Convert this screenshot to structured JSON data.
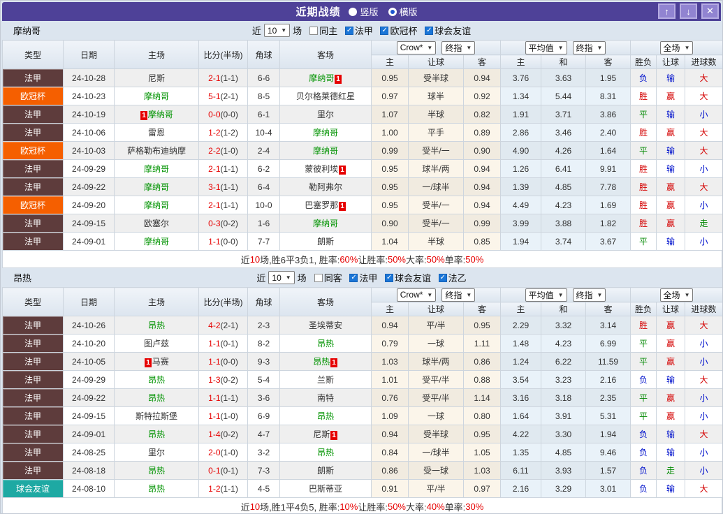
{
  "title_bar": {
    "title": "近期战绩",
    "radio_vertical": "竖版",
    "radio_horizontal": "横版"
  },
  "icons": {
    "up": "↑",
    "down": "↓",
    "close": "✕",
    "dropdown": "▼"
  },
  "columns": {
    "type": "类型",
    "date": "日期",
    "home": "主场",
    "score": "比分(半场)",
    "corner": "角球",
    "away": "客场",
    "crow_select": "Crow*",
    "final_select": "终指",
    "avg_select": "平均值",
    "final_select2": "终指",
    "full_select": "全场",
    "sub_home": "主",
    "sub_handicap": "让球",
    "sub_away": "客",
    "sub_avg_home": "主",
    "sub_avg_draw": "和",
    "sub_avg_away": "客",
    "sub_wdl": "胜负",
    "sub_let": "让球",
    "sub_goals": "进球数"
  },
  "monaco": {
    "team": "摩纳哥",
    "filter": {
      "recent_label": "近",
      "count": "10",
      "matches_label": "场",
      "checkboxes": [
        {
          "label": "同主",
          "state": ""
        },
        {
          "label": "法甲",
          "state": "on"
        },
        {
          "label": "欧冠杯",
          "state": "on"
        },
        {
          "label": "球会友谊",
          "state": "on"
        }
      ]
    },
    "rows": [
      {
        "type": "法甲",
        "tc": "ligue1",
        "date": "24-10-28",
        "hcard": "",
        "home": "尼斯",
        "hc": "",
        "ft": "2-1",
        "ht": "(1-1)",
        "corner": "6-6",
        "away": "摩纳哥",
        "ac": "self",
        "acard": "1",
        "o1": "0.95",
        "hd": "受半球",
        "o2": "0.94",
        "m1": "3.76",
        "m2": "3.63",
        "m3": "1.95",
        "r1": "负",
        "r1c": "blue",
        "r2": "输",
        "r2c": "blue",
        "r3": "大",
        "r3c": "red"
      },
      {
        "type": "欧冠杯",
        "tc": "ucl",
        "date": "24-10-23",
        "hcard": "",
        "home": "摩纳哥",
        "hc": "self",
        "ft": "5-1",
        "ht": "(2-1)",
        "corner": "8-5",
        "away": "贝尔格莱德红星",
        "ac": "",
        "acard": "",
        "o1": "0.97",
        "hd": "球半",
        "o2": "0.92",
        "m1": "1.34",
        "m2": "5.44",
        "m3": "8.31",
        "r1": "胜",
        "r1c": "red",
        "r2": "赢",
        "r2c": "red",
        "r3": "大",
        "r3c": "red"
      },
      {
        "type": "法甲",
        "tc": "ligue1",
        "date": "24-10-19",
        "hcard": "1",
        "home": "摩纳哥",
        "hc": "self",
        "ft": "0-0",
        "ht": "(0-0)",
        "corner": "6-1",
        "away": "里尔",
        "ac": "",
        "acard": "",
        "o1": "1.07",
        "hd": "半球",
        "o2": "0.82",
        "m1": "1.91",
        "m2": "3.71",
        "m3": "3.86",
        "r1": "平",
        "r1c": "green",
        "r2": "输",
        "r2c": "blue",
        "r3": "小",
        "r3c": "blue"
      },
      {
        "type": "法甲",
        "tc": "ligue1",
        "date": "24-10-06",
        "hcard": "",
        "home": "雷恩",
        "hc": "",
        "ft": "1-2",
        "ht": "(1-2)",
        "corner": "10-4",
        "away": "摩纳哥",
        "ac": "self",
        "acard": "",
        "o1": "1.00",
        "hd": "平手",
        "o2": "0.89",
        "m1": "2.86",
        "m2": "3.46",
        "m3": "2.40",
        "r1": "胜",
        "r1c": "red",
        "r2": "赢",
        "r2c": "red",
        "r3": "大",
        "r3c": "red"
      },
      {
        "type": "欧冠杯",
        "tc": "ucl",
        "date": "24-10-03",
        "hcard": "",
        "home": "萨格勒布迪纳摩",
        "hc": "",
        "ft": "2-2",
        "ht": "(1-0)",
        "corner": "2-4",
        "away": "摩纳哥",
        "ac": "self",
        "acard": "",
        "o1": "0.99",
        "hd": "受半/一",
        "o2": "0.90",
        "m1": "4.90",
        "m2": "4.26",
        "m3": "1.64",
        "r1": "平",
        "r1c": "green",
        "r2": "输",
        "r2c": "blue",
        "r3": "大",
        "r3c": "red"
      },
      {
        "type": "法甲",
        "tc": "ligue1",
        "date": "24-09-29",
        "hcard": "",
        "home": "摩纳哥",
        "hc": "self",
        "ft": "2-1",
        "ht": "(1-1)",
        "corner": "6-2",
        "away": "蒙彼利埃",
        "ac": "",
        "acard": "1",
        "o1": "0.95",
        "hd": "球半/两",
        "o2": "0.94",
        "m1": "1.26",
        "m2": "6.41",
        "m3": "9.91",
        "r1": "胜",
        "r1c": "red",
        "r2": "输",
        "r2c": "blue",
        "r3": "小",
        "r3c": "blue"
      },
      {
        "type": "法甲",
        "tc": "ligue1",
        "date": "24-09-22",
        "hcard": "",
        "home": "摩纳哥",
        "hc": "self",
        "ft": "3-1",
        "ht": "(1-1)",
        "corner": "6-4",
        "away": "勒阿弗尔",
        "ac": "",
        "acard": "",
        "o1": "0.95",
        "hd": "一/球半",
        "o2": "0.94",
        "m1": "1.39",
        "m2": "4.85",
        "m3": "7.78",
        "r1": "胜",
        "r1c": "red",
        "r2": "赢",
        "r2c": "red",
        "r3": "大",
        "r3c": "red"
      },
      {
        "type": "欧冠杯",
        "tc": "ucl",
        "date": "24-09-20",
        "hcard": "",
        "home": "摩纳哥",
        "hc": "self",
        "ft": "2-1",
        "ht": "(1-1)",
        "corner": "10-0",
        "away": "巴塞罗那",
        "ac": "",
        "acard": "1",
        "o1": "0.95",
        "hd": "受半/一",
        "o2": "0.94",
        "m1": "4.49",
        "m2": "4.23",
        "m3": "1.69",
        "r1": "胜",
        "r1c": "red",
        "r2": "赢",
        "r2c": "red",
        "r3": "小",
        "r3c": "blue"
      },
      {
        "type": "法甲",
        "tc": "ligue1",
        "date": "24-09-15",
        "hcard": "",
        "home": "欧塞尔",
        "hc": "",
        "ft": "0-3",
        "ht": "(0-2)",
        "corner": "1-6",
        "away": "摩纳哥",
        "ac": "self",
        "acard": "",
        "o1": "0.90",
        "hd": "受半/一",
        "o2": "0.99",
        "m1": "3.99",
        "m2": "3.88",
        "m3": "1.82",
        "r1": "胜",
        "r1c": "red",
        "r2": "赢",
        "r2c": "red",
        "r3": "走",
        "r3c": "green"
      },
      {
        "type": "法甲",
        "tc": "ligue1",
        "date": "24-09-01",
        "hcard": "",
        "home": "摩纳哥",
        "hc": "self",
        "ft": "1-1",
        "ht": "(0-0)",
        "corner": "7-7",
        "away": "朗斯",
        "ac": "",
        "acard": "",
        "o1": "1.04",
        "hd": "半球",
        "o2": "0.85",
        "m1": "1.94",
        "m2": "3.74",
        "m3": "3.67",
        "r1": "平",
        "r1c": "green",
        "r2": "输",
        "r2c": "blue",
        "r3": "小",
        "r3c": "blue"
      }
    ],
    "summary": [
      {
        "t": "近"
      },
      {
        "t": "10",
        "c": "red"
      },
      {
        "t": "场,胜6平3负1, 胜率:"
      },
      {
        "t": "60%",
        "c": "red"
      },
      {
        "t": " 让胜率:"
      },
      {
        "t": "50%",
        "c": "red"
      },
      {
        "t": " 大率:"
      },
      {
        "t": "50%",
        "c": "red"
      },
      {
        "t": " 单率:"
      },
      {
        "t": "50%",
        "c": "red"
      }
    ]
  },
  "angers": {
    "team": "昂热",
    "filter": {
      "recent_label": "近",
      "count": "10",
      "matches_label": "场",
      "checkboxes": [
        {
          "label": "同客",
          "state": ""
        },
        {
          "label": "法甲",
          "state": "on"
        },
        {
          "label": "球会友谊",
          "state": "on"
        },
        {
          "label": "法乙",
          "state": "on"
        }
      ]
    },
    "rows": [
      {
        "type": "法甲",
        "tc": "ligue1",
        "date": "24-10-26",
        "hcard": "",
        "home": "昂热",
        "hc": "self",
        "ft": "4-2",
        "ht": "(2-1)",
        "corner": "2-3",
        "away": "圣埃蒂安",
        "ac": "",
        "acard": "",
        "o1": "0.94",
        "hd": "平/半",
        "o2": "0.95",
        "m1": "2.29",
        "m2": "3.32",
        "m3": "3.14",
        "r1": "胜",
        "r1c": "red",
        "r2": "赢",
        "r2c": "red",
        "r3": "大",
        "r3c": "red"
      },
      {
        "type": "法甲",
        "tc": "ligue1",
        "date": "24-10-20",
        "hcard": "",
        "home": "图卢兹",
        "hc": "",
        "ft": "1-1",
        "ht": "(0-1)",
        "corner": "8-2",
        "away": "昂热",
        "ac": "self",
        "acard": "",
        "o1": "0.79",
        "hd": "一球",
        "o2": "1.11",
        "m1": "1.48",
        "m2": "4.23",
        "m3": "6.99",
        "r1": "平",
        "r1c": "green",
        "r2": "赢",
        "r2c": "red",
        "r3": "小",
        "r3c": "blue"
      },
      {
        "type": "法甲",
        "tc": "ligue1",
        "date": "24-10-05",
        "hcard": "1",
        "home": "马赛",
        "hc": "",
        "ft": "1-1",
        "ht": "(0-0)",
        "corner": "9-3",
        "away": "昂热",
        "ac": "self",
        "acard": "1",
        "o1": "1.03",
        "hd": "球半/两",
        "o2": "0.86",
        "m1": "1.24",
        "m2": "6.22",
        "m3": "11.59",
        "r1": "平",
        "r1c": "green",
        "r2": "赢",
        "r2c": "red",
        "r3": "小",
        "r3c": "blue"
      },
      {
        "type": "法甲",
        "tc": "ligue1",
        "date": "24-09-29",
        "hcard": "",
        "home": "昂热",
        "hc": "self",
        "ft": "1-3",
        "ht": "(0-2)",
        "corner": "5-4",
        "away": "兰斯",
        "ac": "",
        "acard": "",
        "o1": "1.01",
        "hd": "受平/半",
        "o2": "0.88",
        "m1": "3.54",
        "m2": "3.23",
        "m3": "2.16",
        "r1": "负",
        "r1c": "blue",
        "r2": "输",
        "r2c": "blue",
        "r3": "大",
        "r3c": "red"
      },
      {
        "type": "法甲",
        "tc": "ligue1",
        "date": "24-09-22",
        "hcard": "",
        "home": "昂热",
        "hc": "self",
        "ft": "1-1",
        "ht": "(1-1)",
        "corner": "3-6",
        "away": "南特",
        "ac": "",
        "acard": "",
        "o1": "0.76",
        "hd": "受平/半",
        "o2": "1.14",
        "m1": "3.16",
        "m2": "3.18",
        "m3": "2.35",
        "r1": "平",
        "r1c": "green",
        "r2": "赢",
        "r2c": "red",
        "r3": "小",
        "r3c": "blue"
      },
      {
        "type": "法甲",
        "tc": "ligue1",
        "date": "24-09-15",
        "hcard": "",
        "home": "斯特拉斯堡",
        "hc": "",
        "ft": "1-1",
        "ht": "(1-0)",
        "corner": "6-9",
        "away": "昂热",
        "ac": "self",
        "acard": "",
        "o1": "1.09",
        "hd": "一球",
        "o2": "0.80",
        "m1": "1.64",
        "m2": "3.91",
        "m3": "5.31",
        "r1": "平",
        "r1c": "green",
        "r2": "赢",
        "r2c": "red",
        "r3": "小",
        "r3c": "blue"
      },
      {
        "type": "法甲",
        "tc": "ligue1",
        "date": "24-09-01",
        "hcard": "",
        "home": "昂热",
        "hc": "self",
        "ft": "1-4",
        "ht": "(0-2)",
        "corner": "4-7",
        "away": "尼斯",
        "ac": "",
        "acard": "1",
        "o1": "0.94",
        "hd": "受半球",
        "o2": "0.95",
        "m1": "4.22",
        "m2": "3.30",
        "m3": "1.94",
        "r1": "负",
        "r1c": "blue",
        "r2": "输",
        "r2c": "blue",
        "r3": "大",
        "r3c": "red"
      },
      {
        "type": "法甲",
        "tc": "ligue1",
        "date": "24-08-25",
        "hcard": "",
        "home": "里尔",
        "hc": "",
        "ft": "2-0",
        "ht": "(1-0)",
        "corner": "3-2",
        "away": "昂热",
        "ac": "self",
        "acard": "",
        "o1": "0.84",
        "hd": "一/球半",
        "o2": "1.05",
        "m1": "1.35",
        "m2": "4.85",
        "m3": "9.46",
        "r1": "负",
        "r1c": "blue",
        "r2": "输",
        "r2c": "blue",
        "r3": "小",
        "r3c": "blue"
      },
      {
        "type": "法甲",
        "tc": "ligue1",
        "date": "24-08-18",
        "hcard": "",
        "home": "昂热",
        "hc": "self",
        "ft": "0-1",
        "ht": "(0-1)",
        "corner": "7-3",
        "away": "朗斯",
        "ac": "",
        "acard": "",
        "o1": "0.86",
        "hd": "受一球",
        "o2": "1.03",
        "m1": "6.11",
        "m2": "3.93",
        "m3": "1.57",
        "r1": "负",
        "r1c": "blue",
        "r2": "走",
        "r2c": "green",
        "r3": "小",
        "r3c": "blue"
      },
      {
        "type": "球会友谊",
        "tc": "friendly",
        "date": "24-08-10",
        "hcard": "",
        "home": "昂热",
        "hc": "self",
        "ft": "1-2",
        "ht": "(1-1)",
        "corner": "4-5",
        "away": "巴斯蒂亚",
        "ac": "",
        "acard": "",
        "o1": "0.91",
        "hd": "平/半",
        "o2": "0.97",
        "m1": "2.16",
        "m2": "3.29",
        "m3": "3.01",
        "r1": "负",
        "r1c": "blue",
        "r2": "输",
        "r2c": "blue",
        "r3": "大",
        "r3c": "red"
      }
    ],
    "summary": [
      {
        "t": "近"
      },
      {
        "t": "10",
        "c": "red"
      },
      {
        "t": "场,胜1平4负5, 胜率:"
      },
      {
        "t": "10%",
        "c": "red"
      },
      {
        "t": " 让胜率:"
      },
      {
        "t": "50%",
        "c": "red"
      },
      {
        "t": " 大率:"
      },
      {
        "t": "40%",
        "c": "red"
      },
      {
        "t": " 单率:"
      },
      {
        "t": "30%",
        "c": "red"
      }
    ]
  }
}
